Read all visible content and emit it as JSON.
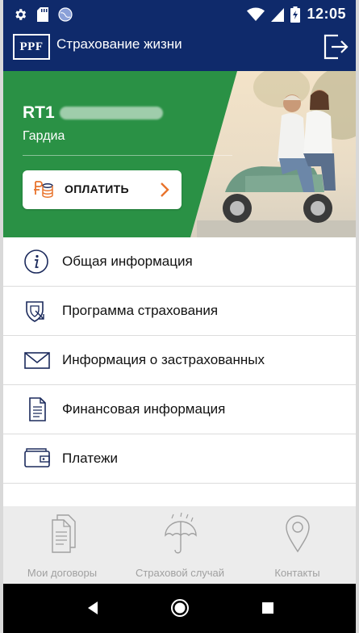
{
  "status_bar": {
    "time": "12:05",
    "icons_left": [
      "gear-icon",
      "sd-card-icon",
      "globe-icon"
    ],
    "icons_right": [
      "wifi-icon",
      "cellular-icon",
      "battery-charging-icon"
    ]
  },
  "app_bar": {
    "logo_text": "PPF",
    "title": "Страхование жизни",
    "action_icon": "logout-icon"
  },
  "contract": {
    "number_prefix": "RT1",
    "product": "Гардиа",
    "pay_button_label": "ОПЛАТИТЬ"
  },
  "menu": {
    "items": [
      {
        "label": "Общая информация",
        "icon": "info-icon"
      },
      {
        "label": "Программа страхования",
        "icon": "shield-icon"
      },
      {
        "label": "Информация о застрахованных",
        "icon": "envelope-icon"
      },
      {
        "label": "Финансовая информация",
        "icon": "document-icon"
      },
      {
        "label": "Платежи",
        "icon": "wallet-icon"
      }
    ]
  },
  "bottom_nav": {
    "items": [
      {
        "label": "Мои договоры",
        "icon": "documents-icon"
      },
      {
        "label": "Страховой случай",
        "icon": "umbrella-icon"
      },
      {
        "label": "Контакты",
        "icon": "location-pin-icon"
      }
    ]
  },
  "colors": {
    "brand_navy": "#0f2a6b",
    "banner_green": "#2a9145",
    "accent_orange": "#e8732c",
    "icon_navy": "#1b2a5c",
    "nav_inactive": "#a0a0a0"
  }
}
